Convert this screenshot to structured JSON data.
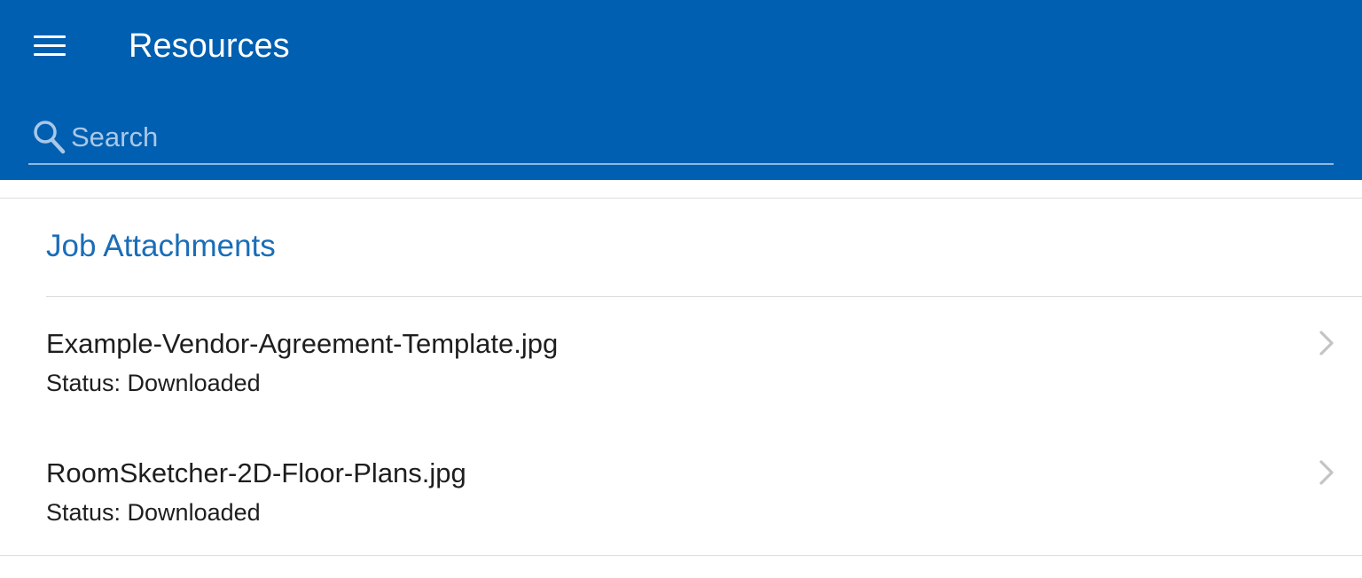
{
  "header": {
    "menu_icon": "hamburger-menu-icon",
    "title": "Resources",
    "background_color": "#005fb0"
  },
  "search": {
    "icon": "search-icon",
    "placeholder": "Search",
    "value": ""
  },
  "section": {
    "title": "Job Attachments",
    "title_color": "#1a6db8"
  },
  "attachments": [
    {
      "name": "Example-Vendor-Agreement-Template.jpg",
      "status": "Status: Downloaded",
      "icon": "chevron-right-icon"
    },
    {
      "name": "RoomSketcher-2D-Floor-Plans.jpg",
      "status": "Status: Downloaded",
      "icon": "chevron-right-icon"
    }
  ]
}
